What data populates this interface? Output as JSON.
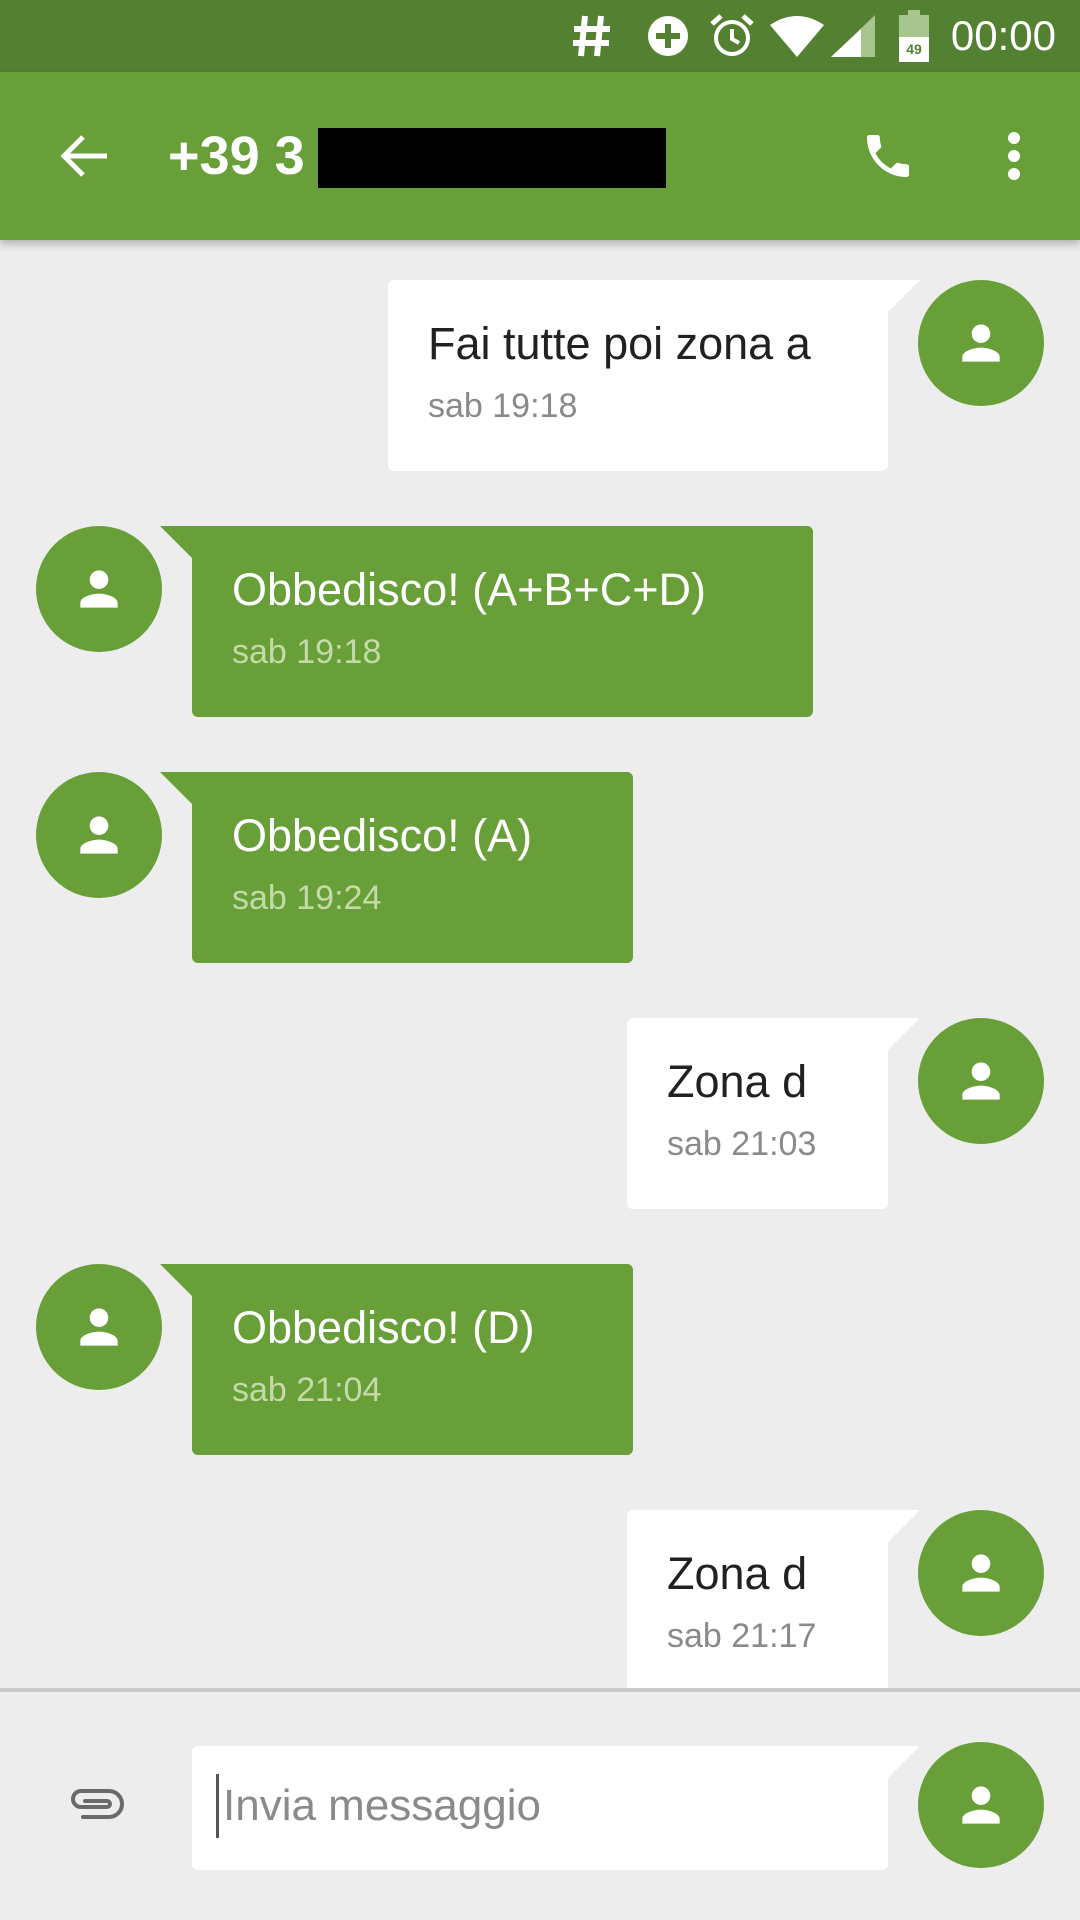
{
  "status_bar": {
    "time": "00:00",
    "battery_level": "49",
    "icons": [
      "hash-icon",
      "data-saver-icon",
      "alarm-icon",
      "wifi-icon",
      "signal-icon",
      "battery-icon"
    ]
  },
  "toolbar": {
    "title": "+39 3",
    "back_icon": "arrow-back-icon",
    "call_icon": "phone-icon",
    "menu_icon": "more-vert-icon"
  },
  "messages": [
    {
      "direction": "outgoing",
      "text": "Fai tutte poi zona a",
      "time": "sab 19:18"
    },
    {
      "direction": "incoming",
      "text": "Obbedisco! (A+B+C+D)",
      "time": "sab 19:18"
    },
    {
      "direction": "incoming",
      "text": "Obbedisco! (A)",
      "time": "sab 19:24"
    },
    {
      "direction": "outgoing",
      "text": "Zona d",
      "time": "sab 21:03"
    },
    {
      "direction": "incoming",
      "text": "Obbedisco! (D)",
      "time": "sab 21:04"
    },
    {
      "direction": "outgoing",
      "text": "Zona d",
      "time": "sab 21:17"
    }
  ],
  "compose": {
    "placeholder": "Invia messaggio",
    "value": ""
  },
  "colors": {
    "status_bar": "#548031",
    "primary": "#689f38",
    "background": "#ededed",
    "outgoing_bubble": "#ffffff"
  }
}
